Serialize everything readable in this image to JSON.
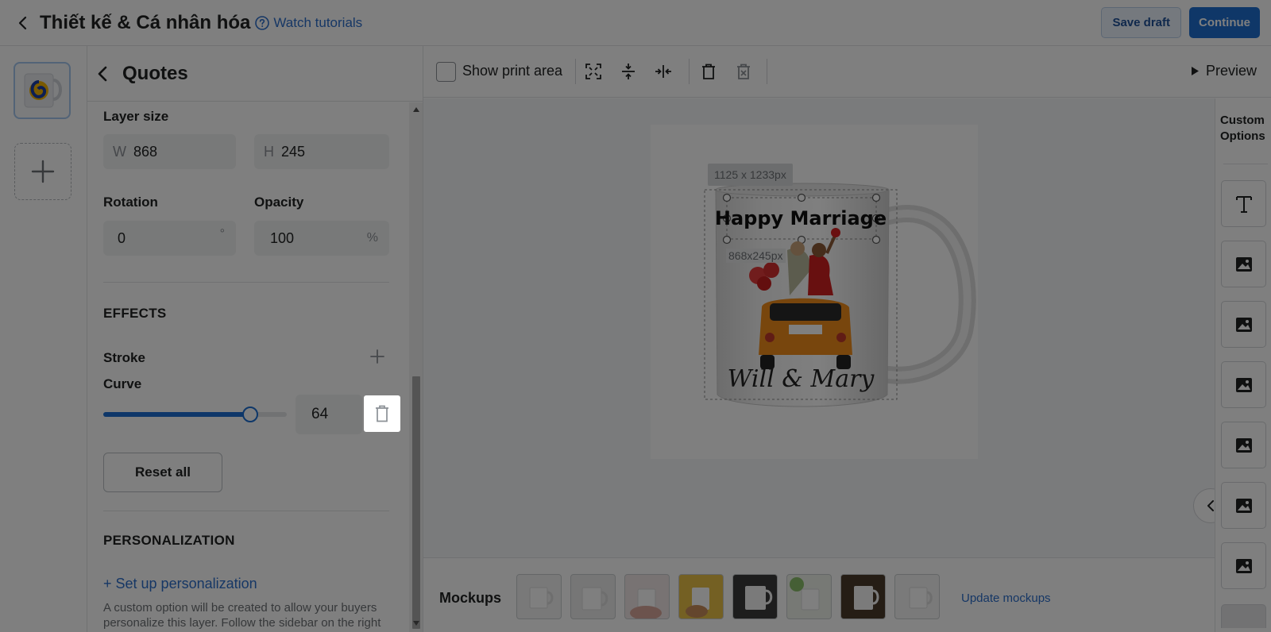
{
  "header": {
    "title": "Thiết kế & Cá nhân hóa",
    "tutorial_link": "Watch tutorials",
    "save_draft": "Save draft",
    "continue": "Continue"
  },
  "panel": {
    "title": "Quotes",
    "layer_size_label": "Layer size",
    "width_prefix": "W",
    "width_value": "868",
    "height_prefix": "H",
    "height_value": "245",
    "rotation_label": "Rotation",
    "rotation_value": "0",
    "rotation_unit": "°",
    "opacity_label": "Opacity",
    "opacity_value": "100",
    "opacity_unit": "%",
    "effects_title": "EFFECTS",
    "stroke_label": "Stroke",
    "curve_label": "Curve",
    "curve_value": "64",
    "curve_fraction": 0.8,
    "reset_all": "Reset all",
    "personalization_title": "PERSONALIZATION",
    "setup_link": "+ Set up personalization",
    "help_line1": "A custom option will be created to allow your buyers",
    "help_line2": "personalize this layer. Follow the sidebar on the right"
  },
  "toolbar": {
    "show_print_area": "Show print area",
    "preview": "Preview"
  },
  "canvas": {
    "artboard_size": "1125 x 1233px",
    "layer_size": "868x245px",
    "mug_text_top": "Happy Marriage",
    "mug_text_bottom": "Will & Mary"
  },
  "mockups": {
    "label": "Mockups",
    "update_link": "Update mockups"
  },
  "custom_options": {
    "title_line1": "Custom",
    "title_line2": "Options"
  },
  "colors": {
    "accent": "#1f6fd1",
    "link": "#2c6ecb"
  }
}
